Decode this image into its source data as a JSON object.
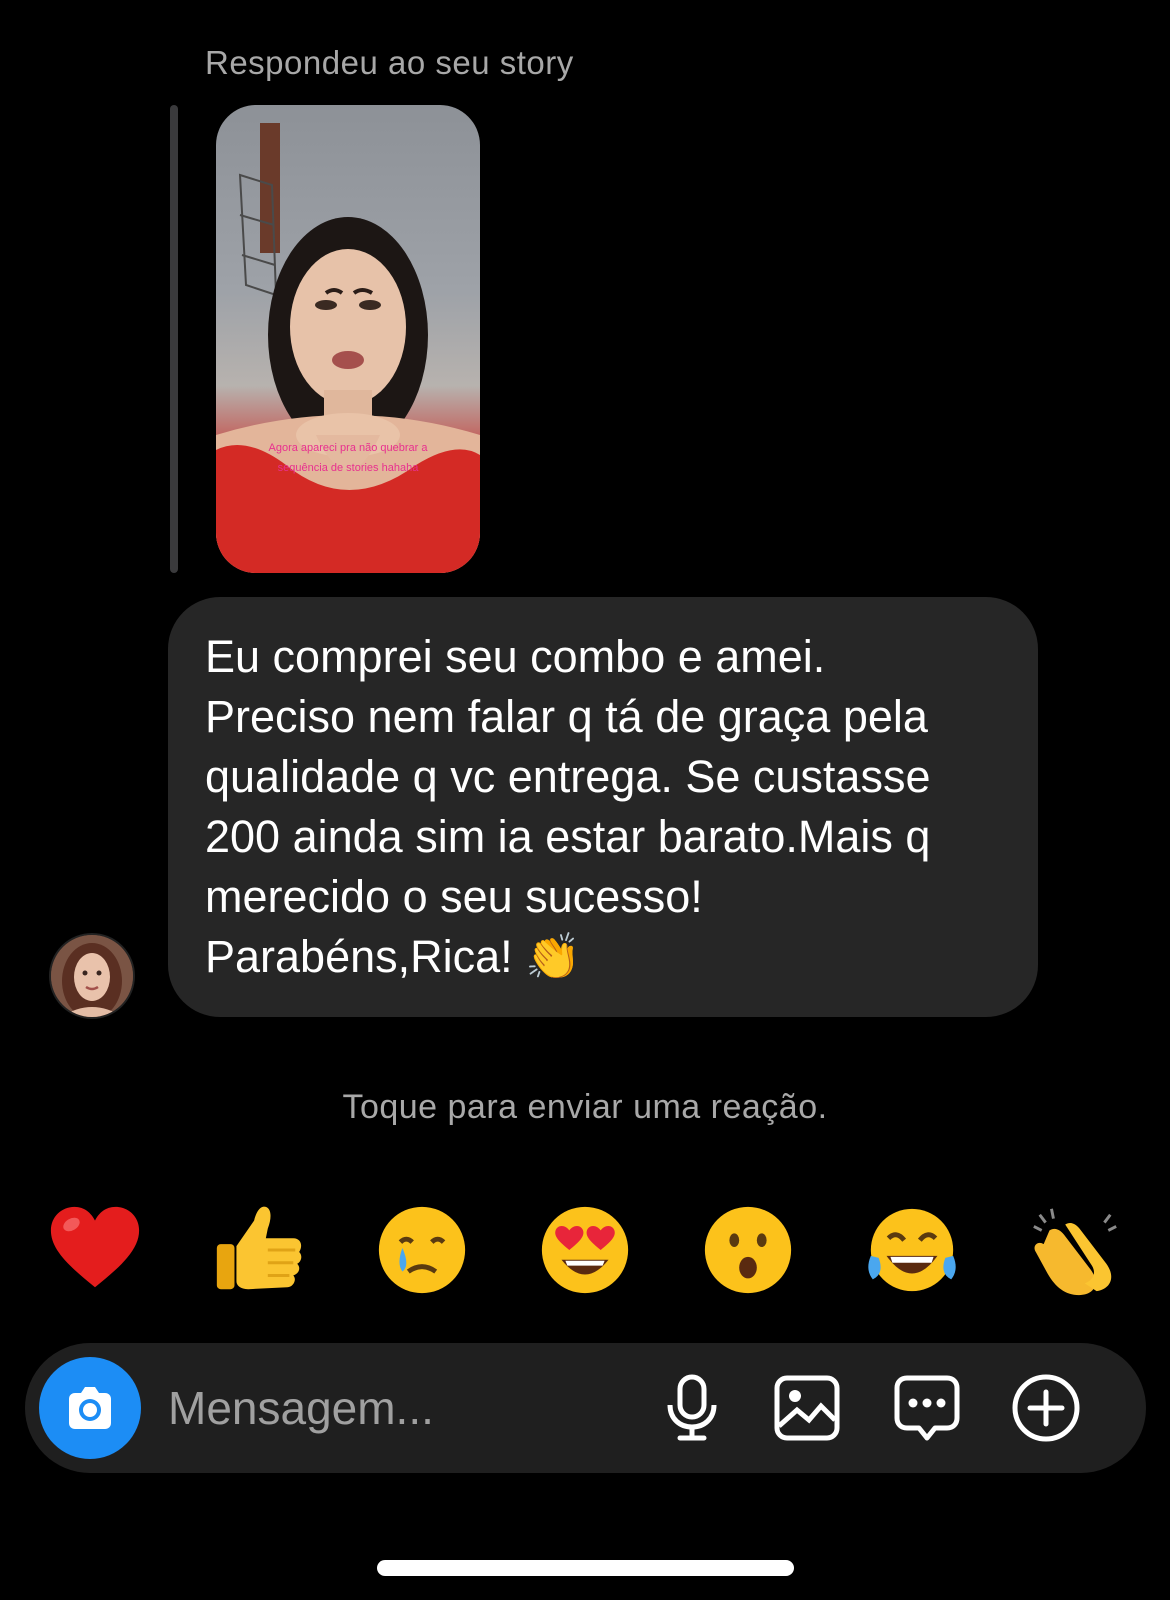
{
  "story_reply": {
    "caption": "Respondeu ao seu story",
    "overlay_text": "Agora apareci pra não quebrar a sequência de stories hahaha"
  },
  "message": {
    "text": "Eu comprei seu combo e amei.\nPreciso nem falar q tá de graça pela\nqualidade q vc entrega. Se custasse\n200 ainda sim ia estar barato.Mais q\nmerecido o seu sucesso!\nParabéns,Rica! 👏"
  },
  "reaction_hint": "Toque para enviar uma reação.",
  "reactions": [
    {
      "emoji": "❤️",
      "name": "heart"
    },
    {
      "emoji": "👍",
      "name": "thumbs-up"
    },
    {
      "emoji": "😢",
      "name": "crying"
    },
    {
      "emoji": "😍",
      "name": "heart-eyes"
    },
    {
      "emoji": "😮",
      "name": "surprised"
    },
    {
      "emoji": "😂",
      "name": "tears-of-joy"
    },
    {
      "emoji": "👏",
      "name": "clapping"
    }
  ],
  "composer": {
    "placeholder": "Mensagem...",
    "icons": [
      "camera-icon",
      "microphone-icon",
      "image-icon",
      "sticker-chat-icon",
      "add-icon"
    ]
  },
  "colors": {
    "background": "#000000",
    "bubble": "#262626",
    "composer": "#1f1f1f",
    "camera_button": "#1c8df5",
    "secondary_text": "#a8a8a8"
  }
}
